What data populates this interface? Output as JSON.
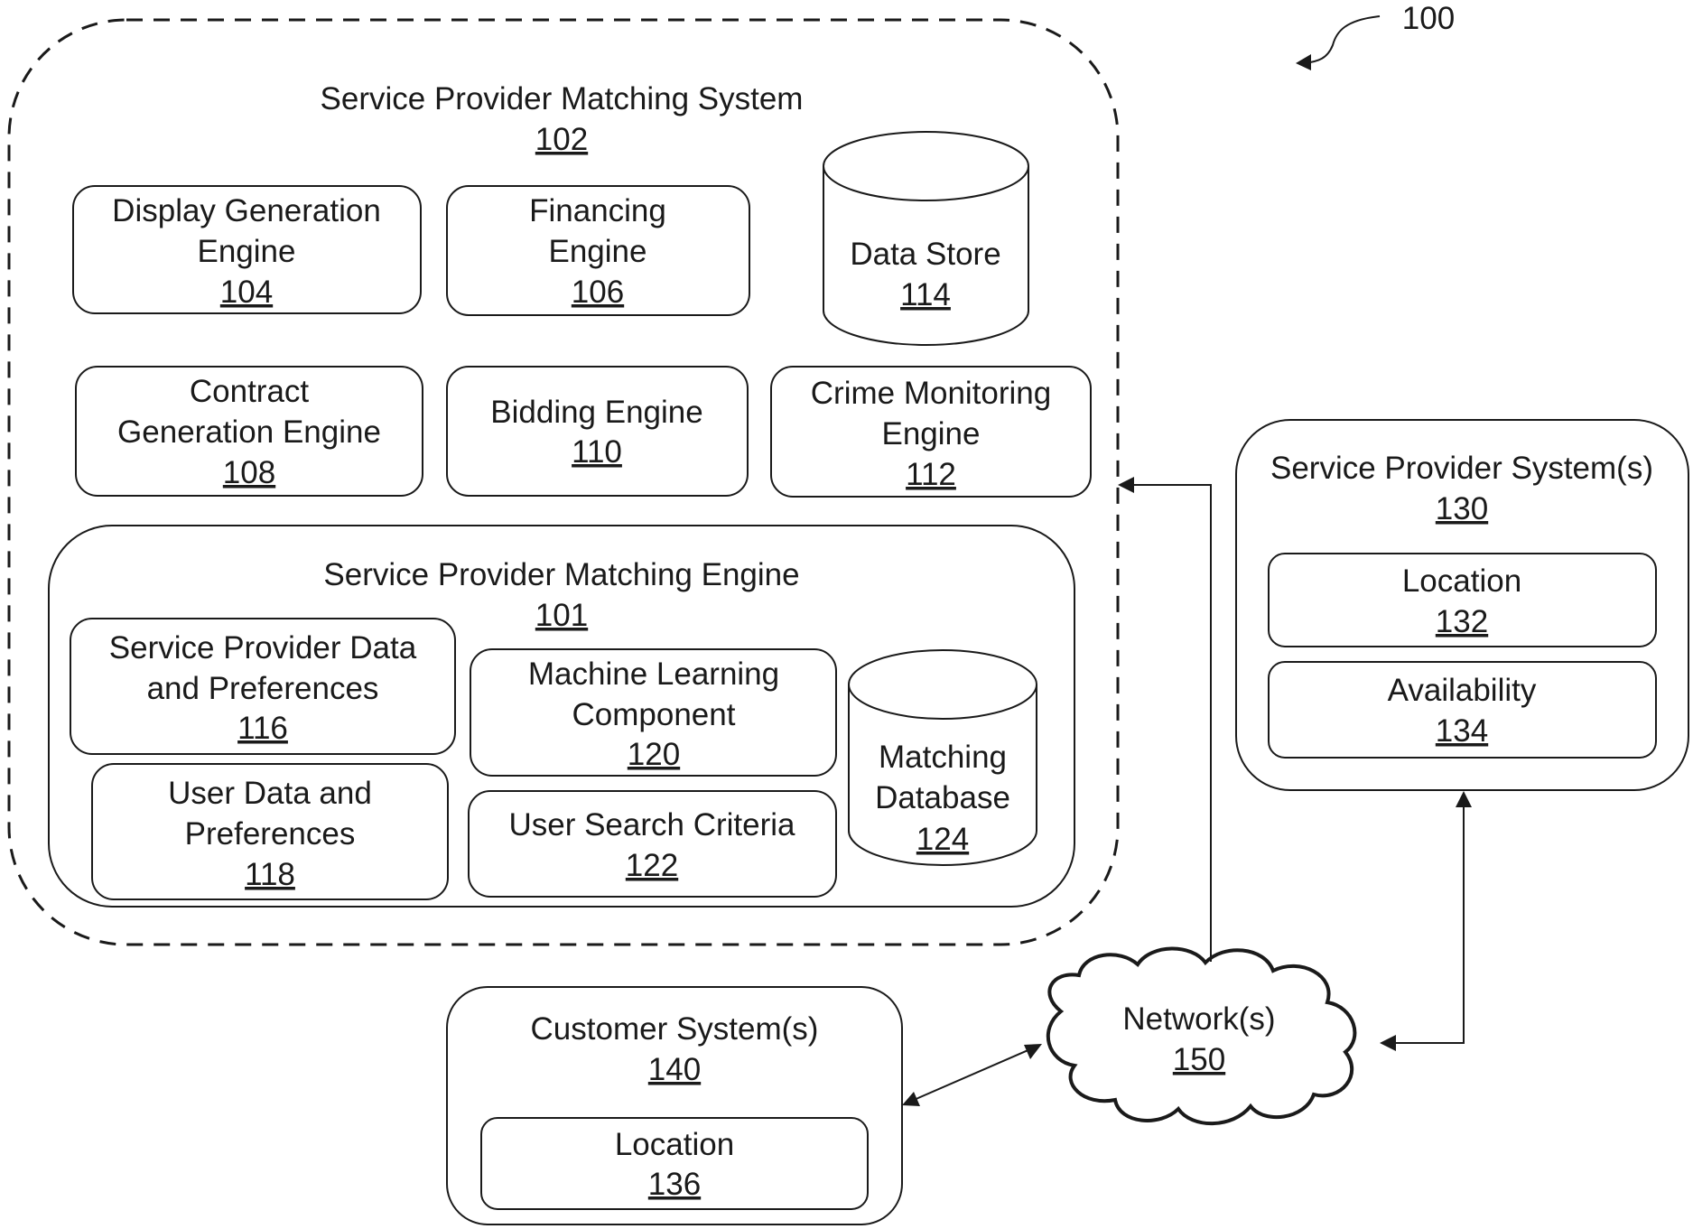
{
  "figure_ref": "100",
  "system": {
    "title": "Service Provider Matching System",
    "ref": "102"
  },
  "components": {
    "display": {
      "l1": "Display Generation",
      "l2": "Engine",
      "ref": "104"
    },
    "financing": {
      "l1": "Financing",
      "l2": "Engine",
      "ref": "106"
    },
    "datastore": {
      "l1": "Data Store",
      "ref": "114"
    },
    "contract": {
      "l1": "Contract",
      "l2": "Generation Engine",
      "ref": "108"
    },
    "bidding": {
      "l1": "Bidding Engine",
      "ref": "110"
    },
    "crime": {
      "l1": "Crime Monitoring",
      "l2": "Engine",
      "ref": "112"
    }
  },
  "matching_engine": {
    "title": "Service Provider Matching Engine",
    "ref": "101",
    "sp_data": {
      "l1": "Service Provider Data",
      "l2": "and Preferences",
      "ref": "116"
    },
    "user_data": {
      "l1": "User Data and",
      "l2": "Preferences",
      "ref": "118"
    },
    "ml": {
      "l1": "Machine Learning",
      "l2": "Component",
      "ref": "120"
    },
    "search": {
      "l1": "User Search Criteria",
      "ref": "122"
    },
    "db": {
      "l1": "Matching",
      "l2": "Database",
      "ref": "124"
    }
  },
  "sp_systems": {
    "title": "Service Provider System(s)",
    "ref": "130",
    "location": {
      "l1": "Location",
      "ref": "132"
    },
    "availability": {
      "l1": "Availability",
      "ref": "134"
    }
  },
  "customer": {
    "title": "Customer System(s)",
    "ref": "140",
    "location": {
      "l1": "Location",
      "ref": "136"
    }
  },
  "network": {
    "title": "Network(s)",
    "ref": "150"
  }
}
